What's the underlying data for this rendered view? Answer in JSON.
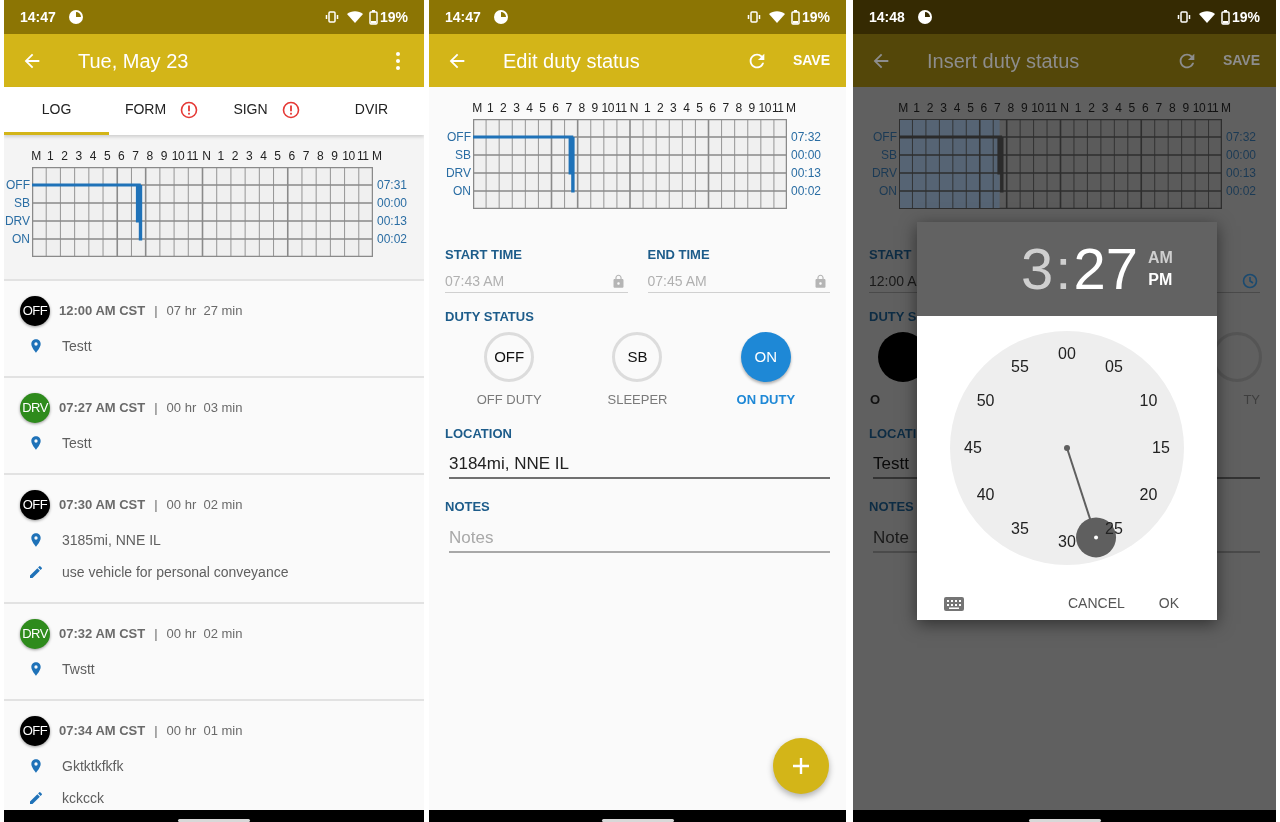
{
  "screens": [
    {
      "kind": "day_log",
      "status_bar": {
        "time": "14:47",
        "battery": "19%"
      },
      "app_bar": {
        "title": "Tue, May 23",
        "actions": [
          {
            "kind": "menu"
          }
        ]
      },
      "tabs": [
        {
          "label": "LOG",
          "selected": true,
          "alert": false
        },
        {
          "label": "FORM",
          "selected": false,
          "alert": true
        },
        {
          "label": "SIGN",
          "selected": false,
          "alert": true
        },
        {
          "label": "DVIR",
          "selected": false,
          "alert": false
        }
      ],
      "log_graph": {
        "hours": [
          "M",
          "1",
          "2",
          "3",
          "4",
          "5",
          "6",
          "7",
          "8",
          "9",
          "10",
          "11",
          "N",
          "1",
          "2",
          "3",
          "4",
          "5",
          "6",
          "7",
          "8",
          "9",
          "10",
          "11",
          "M"
        ],
        "rows": [
          {
            "label": "OFF",
            "total": "07:31"
          },
          {
            "label": "SB",
            "total": "00:00"
          },
          {
            "label": "DRV",
            "total": "00:13"
          },
          {
            "label": "ON",
            "total": "00:02"
          }
        ]
      },
      "events": [
        {
          "status": "OFF",
          "color": "#000000",
          "time": "12:00 AM CST",
          "separator": "|",
          "duration": "07 hr  27 min",
          "location": "Testt"
        },
        {
          "status": "DRV",
          "color": "#2e8b1c",
          "time": "07:27 AM CST",
          "separator": "|",
          "duration": "00 hr  03 min",
          "location": "Testt"
        },
        {
          "status": "OFF",
          "color": "#000000",
          "time": "07:30 AM CST",
          "separator": "|",
          "duration": "00 hr  02 min",
          "location": "3185mi, NNE IL",
          "note": "use vehicle for personal conveyance"
        },
        {
          "status": "DRV",
          "color": "#2e8b1c",
          "time": "07:32 AM CST",
          "separator": "|",
          "duration": "00 hr  02 min",
          "location": "Twstt"
        },
        {
          "status": "OFF",
          "color": "#000000",
          "time": "07:34 AM CST",
          "separator": "|",
          "duration": "00 hr  01 min",
          "location": "Gktktkfkfk",
          "note": "kckcck"
        }
      ]
    },
    {
      "kind": "edit_status",
      "status_bar": {
        "time": "14:47",
        "battery": "19%"
      },
      "app_bar": {
        "title": "Edit duty status",
        "actions": [
          {
            "kind": "refresh"
          },
          {
            "kind": "save",
            "label": "SAVE"
          }
        ]
      },
      "log_graph": {
        "hours": [
          "M",
          "1",
          "2",
          "3",
          "4",
          "5",
          "6",
          "7",
          "8",
          "9",
          "10",
          "11",
          "N",
          "1",
          "2",
          "3",
          "4",
          "5",
          "6",
          "7",
          "8",
          "9",
          "10",
          "11",
          "M"
        ],
        "rows": [
          {
            "label": "OFF",
            "total": "07:32"
          },
          {
            "label": "SB",
            "total": "00:00"
          },
          {
            "label": "DRV",
            "total": "00:13"
          },
          {
            "label": "ON",
            "total": "00:02"
          }
        ]
      },
      "form": {
        "start_time": {
          "label": "START TIME",
          "value": "07:43 AM",
          "locked": true
        },
        "end_time": {
          "label": "END TIME",
          "value": "07:45 AM",
          "locked": true
        },
        "duty_status": {
          "label": "DUTY STATUS",
          "options": [
            {
              "badge": "OFF",
              "label": "OFF DUTY",
              "selected": false
            },
            {
              "badge": "SB",
              "label": "SLEEPER",
              "selected": false
            },
            {
              "badge": "ON",
              "label": "ON DUTY",
              "selected": true
            }
          ]
        },
        "location": {
          "label": "LOCATION",
          "value": "3184mi, NNE IL"
        },
        "notes": {
          "label": "NOTES",
          "placeholder": "Notes"
        }
      }
    },
    {
      "kind": "insert_status",
      "status_bar": {
        "time": "14:48",
        "battery": "19%"
      },
      "app_bar": {
        "title": "Insert duty status",
        "actions": [
          {
            "kind": "refresh"
          },
          {
            "kind": "save",
            "label": "SAVE"
          }
        ]
      },
      "log_graph": {
        "hours": [
          "M",
          "1",
          "2",
          "3",
          "4",
          "5",
          "6",
          "7",
          "8",
          "9",
          "10",
          "11",
          "N",
          "1",
          "2",
          "3",
          "4",
          "5",
          "6",
          "7",
          "8",
          "9",
          "10",
          "11",
          "M"
        ],
        "rows": [
          {
            "label": "OFF",
            "total": "07:32"
          },
          {
            "label": "SB",
            "total": "00:00"
          },
          {
            "label": "DRV",
            "total": "00:13"
          },
          {
            "label": "ON",
            "total": "00:02"
          }
        ]
      },
      "form": {
        "start_time": {
          "label": "START",
          "value": "12:00 A",
          "locked": false
        },
        "duty_status": {
          "label": "DUTY S",
          "options": [
            {
              "label": "O",
              "selected": true
            },
            {
              "label": "TY",
              "selected": false
            }
          ]
        },
        "location": {
          "label": "LOCATI",
          "value": "Testt"
        },
        "notes": {
          "label": "NOTES",
          "placeholder": "Note"
        }
      },
      "time_picker": {
        "hour": {
          "text": "3",
          "selected": false
        },
        "separator": ":",
        "minute": {
          "text": "27",
          "selected": true
        },
        "periods": [
          {
            "label": "AM",
            "selected": false
          },
          {
            "label": "PM",
            "selected": true
          }
        ],
        "dial": [
          "00",
          "05",
          "10",
          "15",
          "20",
          "25",
          "30",
          "35",
          "40",
          "45",
          "50",
          "55"
        ],
        "buttons": [
          "CANCEL",
          "OK"
        ]
      }
    }
  ]
}
